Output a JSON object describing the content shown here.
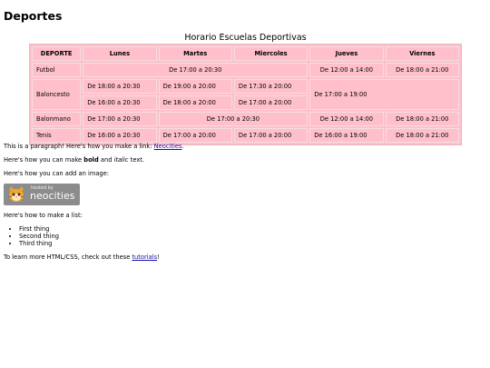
{
  "page": {
    "title": "Deportes"
  },
  "schedule": {
    "caption": "Horario Escuelas Deportivas",
    "headers": [
      "DEPORTE",
      "Lunes",
      "Martes",
      "Miercoles",
      "Jueves",
      "Viernes"
    ],
    "rows": {
      "futbol": {
        "sport": "Futbol",
        "mon_wed": "De 17:00 a 20:30",
        "thu": "De 12:00 a 14:00",
        "fri": "De 18:00 a 21:00"
      },
      "baloncesto": {
        "sport": "Baloncesto",
        "mon_1": "De 18:00 a 20:30",
        "tue_1": "De 19:00 a 20:00",
        "wed_1": "De 17:30 a 20:00",
        "thu_fri": "De 17:00 a 19:00",
        "mon_2": "De 16:00 a 20:30",
        "tue_2": "De 18:00 a 20:00",
        "wed_2": "De 17:00 a 20:00"
      },
      "balonmano": {
        "sport": "Balonmano",
        "mon": "De 17:00 a 20:30",
        "tue_wed": "De 17:00 a 20:30",
        "thu": "De 12:00 a 14:00",
        "fri": "De 18:00 a 21:00"
      },
      "tenis": {
        "sport": "Tenis",
        "mon": "De 16:00 a 20:30",
        "tue": "De 17:00 a 20:00",
        "wed": "De 17:00 a 20:00",
        "thu": "De 16:00 a 19:00",
        "fri": "De 18:00 a 21:00"
      }
    }
  },
  "content": {
    "para1_prefix": "This is a paragraph! Here's how you make a link: ",
    "para1_link": "Neocities",
    "para1_suffix": ".",
    "para2_prefix": "Here's how you can make ",
    "para2_bold": "bold",
    "para2_mid": " and ",
    "para2_italic": "italic",
    "para2_suffix": " text.",
    "para3": "Here's how you can add an image:",
    "badge_hosted": "hosted by",
    "badge_brand": "neocities",
    "list_intro": "Here's how to make a list:",
    "list_items": [
      "First thing",
      "Second thing",
      "Third thing"
    ],
    "para_last_prefix": "To learn more HTML/CSS, check out these ",
    "para_last_link": "tutorials",
    "para_last_suffix": "!"
  },
  "colors": {
    "table_background": "#ffc0cb",
    "link": "#1a0dab",
    "badge_background": "#8c8c8c"
  }
}
